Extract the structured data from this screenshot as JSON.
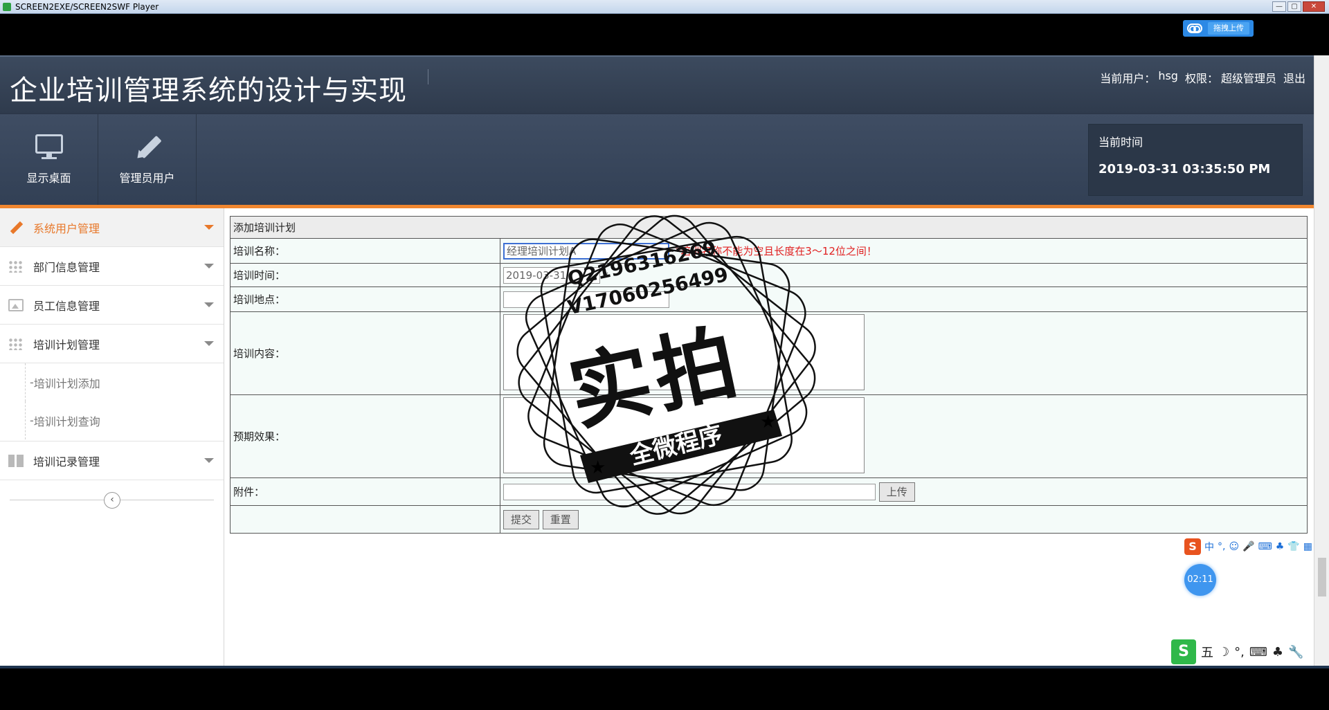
{
  "window": {
    "title": "SCREEN2EXE/SCREEN2SWF Player",
    "controls": [
      "—",
      "▢",
      "✕"
    ]
  },
  "upload_chip": {
    "label": "拖拽上传"
  },
  "app": {
    "title": "企业培训管理系统的设计与实现",
    "user_label": "当前用户：",
    "user_name": "hsg",
    "role_label": "权限：",
    "role_name": "超级管理员",
    "logout": "退出"
  },
  "toolbar": {
    "items": [
      {
        "label": "显示桌面",
        "icon": "monitor-icon"
      },
      {
        "label": "管理员用户",
        "icon": "pencil-icon"
      }
    ],
    "time_label": "当前时间",
    "time_value": "2019-03-31 03:35:50 PM"
  },
  "sidebar": {
    "items": [
      {
        "label": "系统用户管理",
        "icon": "edit-icon",
        "active": true
      },
      {
        "label": "部门信息管理",
        "icon": "grid-icon"
      },
      {
        "label": "员工信息管理",
        "icon": "image-icon"
      },
      {
        "label": "培训计划管理",
        "icon": "grid-icon"
      }
    ],
    "sub_items": [
      "培训计划添加",
      "培训计划查询"
    ],
    "last_item": {
      "label": "培训记录管理",
      "icon": "layout-icon"
    },
    "collapse_icon": "‹"
  },
  "form": {
    "heading": "添加培训计划",
    "name_label": "培训名称：",
    "name_value": "经理培训计划A",
    "name_error": "*培训名称不能为空且长度在3～12位之间！",
    "time_label": "培训时间：",
    "time_value": "2019-03-31",
    "time_required": "*",
    "place_label": "培训地点：",
    "place_value": "",
    "content_label": "培训内容：",
    "effect_label": "预期效果：",
    "attach_label": "附件：",
    "upload_btn": "上传",
    "submit_btn": "提交",
    "reset_btn": "重置"
  },
  "watermark": {
    "qq": "Q2196316269",
    "wx": "V17060256499",
    "big": "实拍",
    "banner": "全微程序"
  },
  "ime_top": {
    "logo": "S",
    "items": [
      "中",
      "°,",
      "☺",
      "🎤",
      "⌨",
      "♣",
      "👕",
      "▦"
    ]
  },
  "timer": "02:11",
  "ime_bottom": {
    "logo": "S",
    "items": [
      "五",
      "☽",
      "°,",
      "⌨",
      "♣",
      "🔧"
    ]
  }
}
